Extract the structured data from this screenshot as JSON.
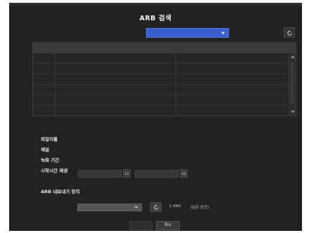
{
  "dialog": {
    "title": "ARB 검색",
    "archive_select_value": "",
    "icons": [
      "chevron-down-icon",
      "refresh-icon",
      "calendar-icon"
    ]
  },
  "table": {
    "headers": [
      "",
      "",
      ""
    ],
    "rows": [
      [
        "",
        "",
        ""
      ],
      [
        "",
        "",
        ""
      ],
      [
        "",
        "",
        ""
      ],
      [
        "",
        "",
        ""
      ],
      [
        "",
        "",
        ""
      ],
      [
        "",
        "",
        ""
      ]
    ]
  },
  "fields": {
    "file_name_label": "파일이름",
    "channel_label": "채널",
    "record_period_label": "녹화 기간",
    "start_time_label": "시작시간 재생",
    "start_date_value": "",
    "start_time_value": ""
  },
  "export": {
    "section_label": "ARB 내보내기 장치",
    "device_value": "",
    "capacity": "1.99G",
    "remaining_label": "(남은 공간)",
    "export_button": ""
  },
  "buttons": {
    "delete": "",
    "cancel": "취소"
  },
  "colors": {
    "background": "#222222",
    "accent": "#3a5fcd"
  }
}
